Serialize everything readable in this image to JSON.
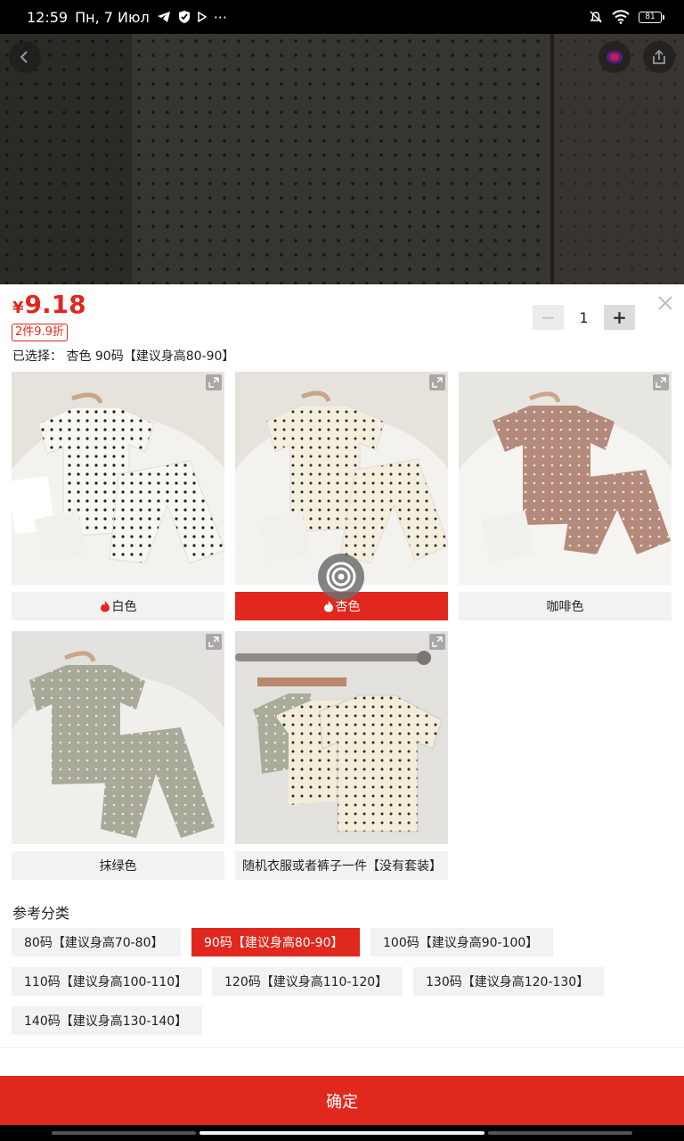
{
  "status_bar": {
    "time": "12:59",
    "date": "Пн, 7 Июл",
    "more": "···",
    "battery": "81"
  },
  "sheet": {
    "currency": "¥",
    "price": "9.18",
    "promo": "2件9.9折",
    "selected": "已选择：  杏色 90码【建议身高80-90】",
    "quantity": "1",
    "qty_minus": "−",
    "qty_plus": "+"
  },
  "colors": [
    {
      "label": "白色",
      "hot": true,
      "selected": false
    },
    {
      "label": "杏色",
      "hot": true,
      "selected": true
    },
    {
      "label": "咖啡色",
      "hot": false,
      "selected": false
    },
    {
      "label": "抹绿色",
      "hot": false,
      "selected": false
    },
    {
      "label": "随机衣服或者裤子一件【没有套装】",
      "hot": false,
      "selected": false
    }
  ],
  "category": {
    "title": "参考分类",
    "sizes": [
      {
        "label": "80码【建议身高70-80】",
        "selected": false
      },
      {
        "label": "90码【建议身高80-90】",
        "selected": true
      },
      {
        "label": "100码【建议身高90-100】",
        "selected": false
      },
      {
        "label": "110码【建议身高100-110】",
        "selected": false
      },
      {
        "label": "120码【建议身高110-120】",
        "selected": false
      },
      {
        "label": "130码【建议身高120-130】",
        "selected": false
      },
      {
        "label": "140码【建议身高130-140】",
        "selected": false
      }
    ]
  },
  "confirm_label": "确定",
  "theme": {
    "accent": "#e0281e",
    "chip_bg": "#f2f2f2"
  }
}
